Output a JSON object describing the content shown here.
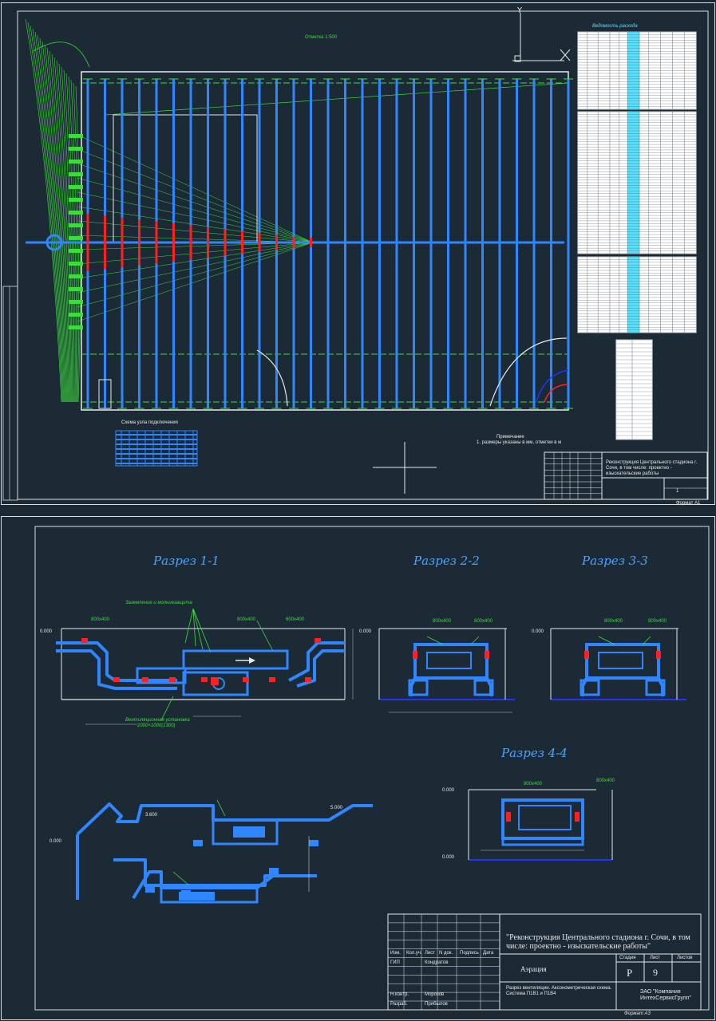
{
  "sheet1": {
    "top_note": "Отметка 1:500",
    "table_title": "Ведомость расхода",
    "legend_caption": "Схема узла подключения",
    "note_text": "Примечание",
    "note_detail": "1. размеры указаны в мм, отметки в м",
    "format": "Формат А1",
    "title_block": {
      "project": "Реконструкция Центрального стадиона г. Сочи, в том числе: проектно - изыскательские работы",
      "sheet_no": "1"
    }
  },
  "sheet2": {
    "section_1": "Разрез 1-1",
    "section_2": "Разрез 2-2",
    "section_3": "Разрез 3-3",
    "section_4": "Разрез 4-4",
    "callout_main": "Заземление и молниезащита",
    "callout_bottom": "Вентиляционная установка",
    "callout_bottom2": "2000×1000(1300)",
    "duct_labels": [
      "800x400",
      "800x400",
      "600x400",
      "800x400",
      "800x400",
      "800x400",
      "800x400",
      "800x400",
      "800x400"
    ],
    "levels": [
      "0.000",
      "3.600",
      "5.000",
      "0.000",
      "0.000",
      "0.000",
      "0.000",
      "0.000"
    ],
    "title_block": {
      "project": "\"Реконструкция Центрального стадиона г. Сочи, в том числе: проектно - изыскательские работы\"",
      "stage_header": "Стадия",
      "sheet_header": "Лист",
      "sheets_header": "Листов",
      "stage": "Р",
      "sheet": "9",
      "section_name": "Аэрация",
      "drawing_name": "Разрез вентиляции. Аксонометрическая схема. Система П1В1 и П1В4",
      "company": "ЗАО \"Компания ИнтехСервисГрупп\"",
      "col_headers": [
        "Изм.",
        "Кол.уч.",
        "Лист",
        "N док.",
        "Подпись",
        "Дата"
      ],
      "roles": [
        "ГИП",
        "Н.контр.",
        "Разраб."
      ],
      "names": [
        "Кондратов",
        "Морозов",
        "Прибылов"
      ],
      "format": "Формат А3"
    }
  },
  "colors": {
    "background": "#1c2a35",
    "duct_blue": "#2f86ff",
    "cyan": "#58e0ff",
    "red": "#ff2020",
    "green": "#3ddc3d",
    "white": "#e6e9ea"
  }
}
